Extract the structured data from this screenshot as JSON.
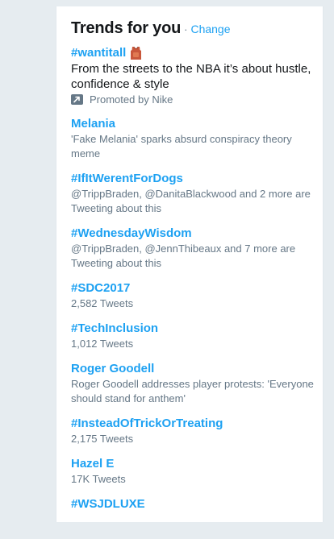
{
  "header": {
    "title": "Trends for you",
    "separator": "·",
    "change_label": "Change"
  },
  "trends": [
    {
      "name": "#wantitall",
      "description": "From the streets to the NBA it’s about hustle, confidence & style",
      "promoted_label": "Promoted by Nike",
      "icon": "shirt-emoji-icon"
    },
    {
      "name": "Melania",
      "description": "'Fake Melania' sparks absurd conspiracy theory meme"
    },
    {
      "name": "#IfItWerentForDogs",
      "description": "@TrippBraden, @DanitaBlackwood and 2 more are Tweeting about this"
    },
    {
      "name": "#WednesdayWisdom",
      "description": "@TrippBraden, @JennThibeaux and 7 more are Tweeting about this"
    },
    {
      "name": "#SDC2017",
      "description": "2,582 Tweets"
    },
    {
      "name": "#TechInclusion",
      "description": "1,012 Tweets"
    },
    {
      "name": "Roger Goodell",
      "description": "Roger Goodell addresses player protests: 'Everyone should stand for anthem'"
    },
    {
      "name": "#InsteadOfTrickOrTreating",
      "description": "2,175 Tweets"
    },
    {
      "name": "Hazel E",
      "description": "17K Tweets"
    },
    {
      "name": "#WSJDLUXE"
    }
  ],
  "colors": {
    "accent": "#1da1f2",
    "text_primary": "#14171a",
    "text_secondary": "#657786",
    "background": "#e6ecf0"
  }
}
